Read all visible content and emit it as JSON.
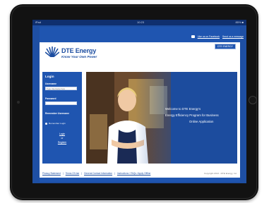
{
  "status_bar": {
    "left": "iPad",
    "time": "10:23",
    "right": "85% ■"
  },
  "top_links": {
    "fb_label": "Like us on Facebook",
    "msg_label": "Send us a message"
  },
  "header": {
    "brand": "DTE Energy",
    "tagline": "Know Your Own Power",
    "button_label": "DTE ENERGY"
  },
  "login": {
    "title": "Login",
    "username_label": "Username",
    "username_value": "Type Username here",
    "password_label": "Password",
    "password_value": "",
    "remember_heading": "Remember Username",
    "remember_label": "Remember Login",
    "login_link": "Login",
    "or_text": "or",
    "register_link": "Register"
  },
  "hero": {
    "line1": "Welcome to DTE Energy's",
    "line2": "Energy Efficiency Program for Business",
    "line3": "Online Application"
  },
  "footer": {
    "links": [
      "Privacy Statement",
      "Terms Of Use",
      "General Contact Information",
      "Instructions / FAQs / Apply Offline"
    ],
    "copyright": "Copyright 2013 - DTE Energy, Inc."
  },
  "colors": {
    "brand_blue": "#1f55b0",
    "dark_blue": "#0f2f6e",
    "device_black": "#121212"
  }
}
